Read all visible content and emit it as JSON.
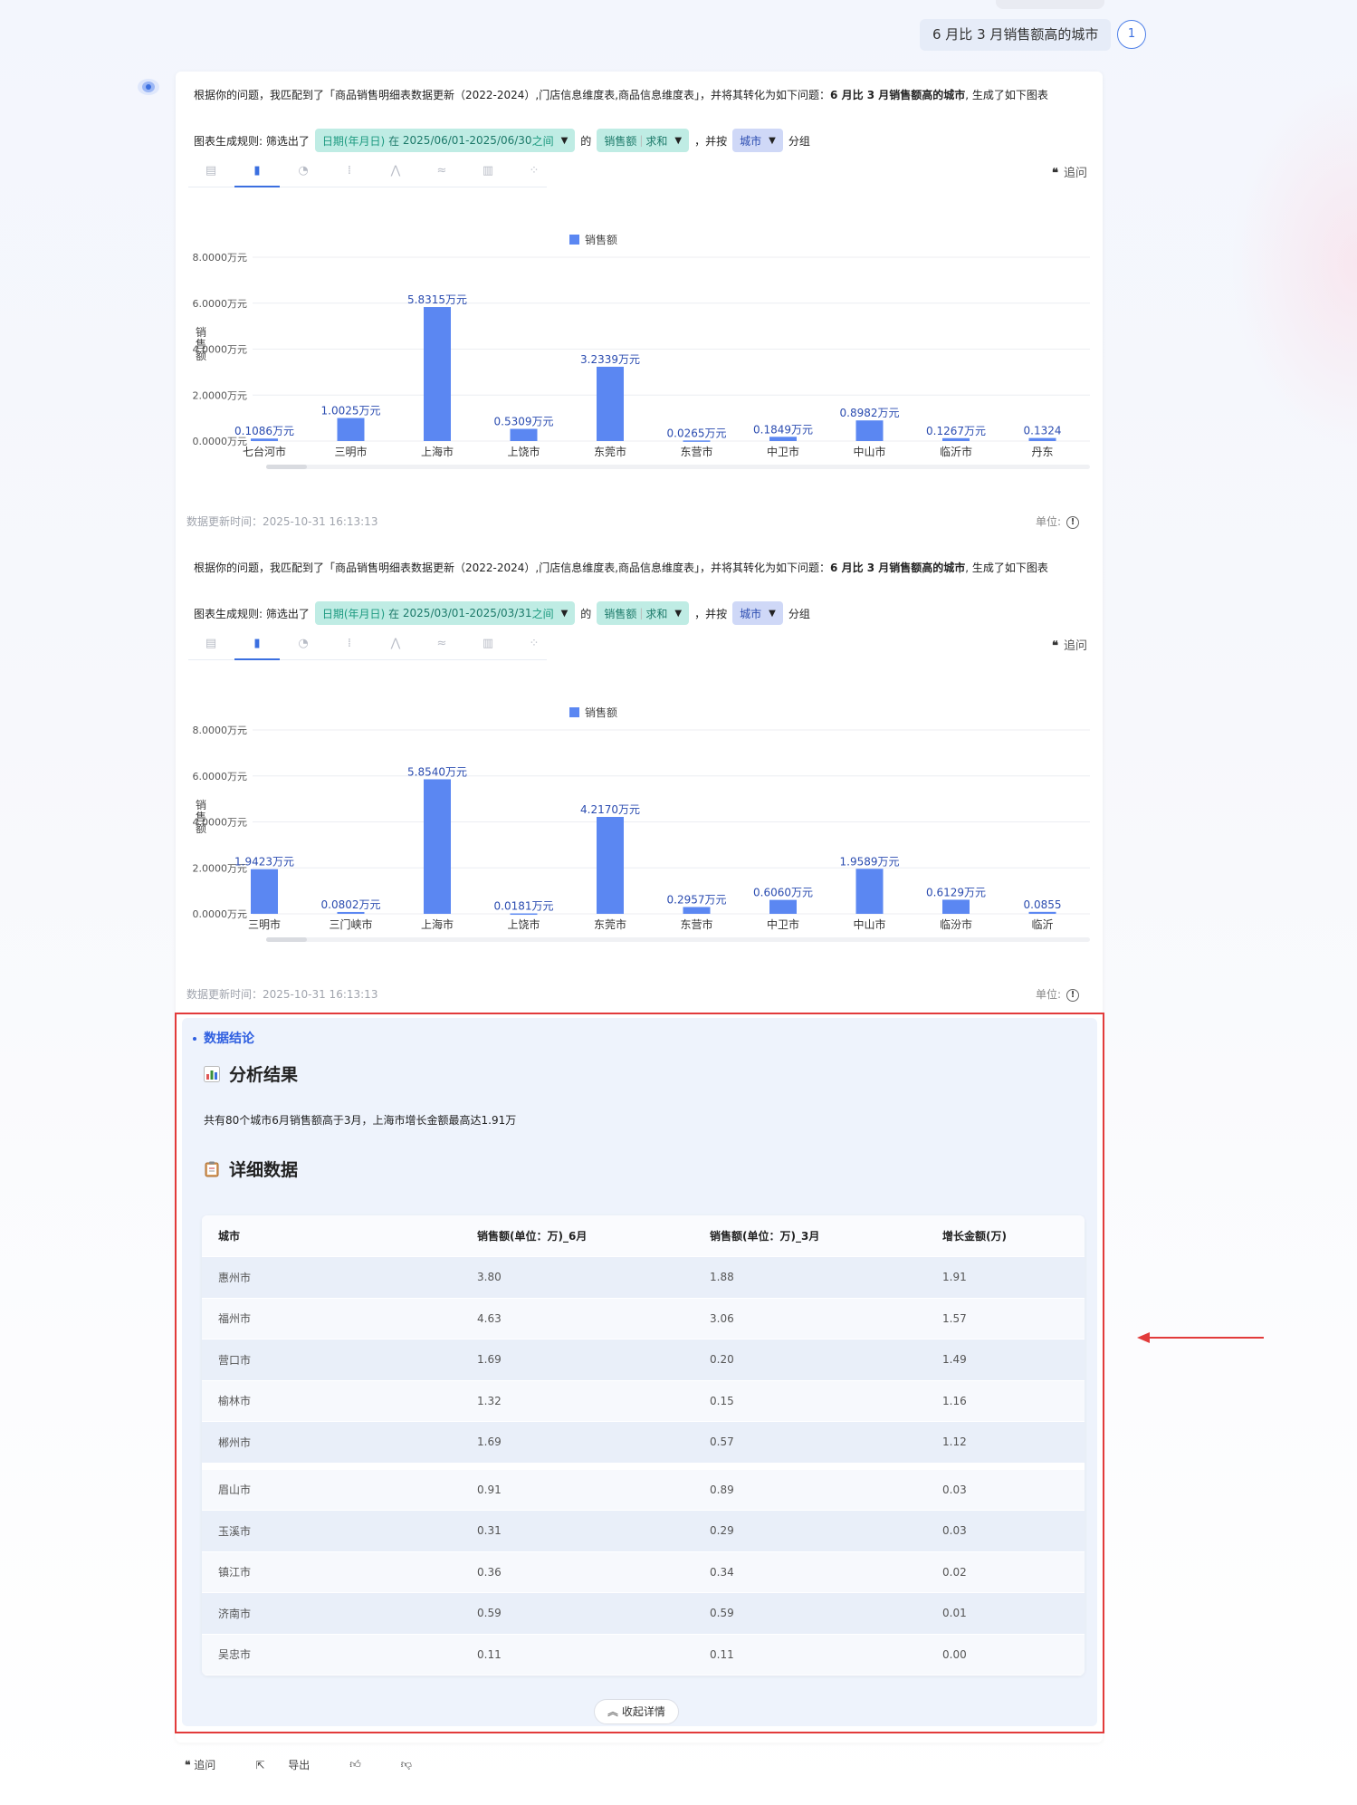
{
  "question": {
    "text": "6 月比 3 月销售额高的城市",
    "badge": "1"
  },
  "sections": [
    {
      "intro_pre": "根据你的问题，我匹配到了「商品销售明细表数据更新（2022-2024）,门店信息维度表,商品信息维度表」，并将其转化为如下问题：",
      "intro_bold": "6 月比 3 月销售额高的城市",
      "intro_post": ", 生成了如下图表",
      "rule_label": "图表生成规则: 筛选出了",
      "date_key": "日期(年月日)",
      "date_in": "在",
      "date_range": "2025/06/01-2025/06/30",
      "date_between": "之间",
      "de": "的",
      "metric": "销售额",
      "agg": "求和",
      "and_by": "，并按",
      "group": "城市",
      "group_suffix": "分组",
      "followup": "追问",
      "updated": "数据更新时间：2025-10-31 16:13:13",
      "unit": "单位:"
    },
    {
      "intro_pre": "根据你的问题，我匹配到了「商品销售明细表数据更新（2022-2024）,门店信息维度表,商品信息维度表」，并将其转化为如下问题：",
      "intro_bold": "6 月比 3 月销售额高的城市",
      "intro_post": ", 生成了如下图表",
      "rule_label": "图表生成规则: 筛选出了",
      "date_key": "日期(年月日)",
      "date_in": "在",
      "date_range": "2025/03/01-2025/03/31",
      "date_between": "之间",
      "de": "的",
      "metric": "销售额",
      "agg": "求和",
      "and_by": "，并按",
      "group": "城市",
      "group_suffix": "分组",
      "followup": "追问",
      "updated": "数据更新时间：2025-10-31 16:13:13",
      "unit": "单位:"
    }
  ],
  "chart_tabs": [
    "table-icon",
    "bar-chart-icon",
    "pie-chart-icon",
    "grouped-icon",
    "line-icon",
    "area-icon",
    "stacked-icon",
    "scatter-icon"
  ],
  "chart_data": [
    {
      "type": "bar",
      "legend": "销售额",
      "ylabel": "销售额",
      "ylim": [
        0,
        8
      ],
      "yticks": [
        "0.0000万元",
        "2.0000万元",
        "4.0000万元",
        "6.0000万元",
        "8.0000万元"
      ],
      "categories": [
        "七台河市",
        "三明市",
        "上海市",
        "上饶市",
        "东莞市",
        "东营市",
        "中卫市",
        "中山市",
        "临沂市",
        "丹东"
      ],
      "values": [
        0.1086,
        1.0025,
        5.8315,
        0.5309,
        3.2339,
        0.0265,
        0.1849,
        0.8982,
        0.1267,
        0.1324
      ],
      "labels": [
        "0.1086万元",
        "1.0025万元",
        "5.8315万元",
        "0.5309万元",
        "3.2339万元",
        "0.0265万元",
        "0.1849万元",
        "0.8982万元",
        "0.1267万元",
        "0.1324"
      ],
      "color": "#5b87f2"
    },
    {
      "type": "bar",
      "legend": "销售额",
      "ylabel": "销售额",
      "ylim": [
        0,
        8
      ],
      "yticks": [
        "0.0000万元",
        "2.0000万元",
        "4.0000万元",
        "6.0000万元",
        "8.0000万元"
      ],
      "categories": [
        "三明市",
        "三门峡市",
        "上海市",
        "上饶市",
        "东莞市",
        "东营市",
        "中卫市",
        "中山市",
        "临汾市",
        "临沂"
      ],
      "values": [
        1.9423,
        0.0802,
        5.854,
        0.0181,
        4.217,
        0.2957,
        0.606,
        1.9589,
        0.6129,
        0.0855
      ],
      "labels": [
        "1.9423万元",
        "0.0802万元",
        "5.8540万元",
        "0.0181万元",
        "4.2170万元",
        "0.2957万元",
        "0.6060万元",
        "1.9589万元",
        "0.6129万元",
        "0.0855"
      ],
      "color": "#5b87f2"
    }
  ],
  "conclusion": {
    "title": "数据结论",
    "analysis_heading": "分析结果",
    "summary": "共有80个城市6月销售额高于3月，上海市增长金额最高达1.91万",
    "detail_heading": "详细数据",
    "columns": [
      "城市",
      "销售额(单位：万)_6月",
      "销售额(单位：万)_3月",
      "增长金额(万)"
    ],
    "rows": [
      [
        "惠州市",
        "3.80",
        "1.88",
        "1.91"
      ],
      [
        "福州市",
        "4.63",
        "3.06",
        "1.57"
      ],
      [
        "营口市",
        "1.69",
        "0.20",
        "1.49"
      ],
      [
        "榆林市",
        "1.32",
        "0.15",
        "1.16"
      ],
      [
        "郴州市",
        "1.69",
        "0.57",
        "1.12"
      ],
      [
        "眉山市",
        "0.91",
        "0.89",
        "0.03"
      ],
      [
        "玉溪市",
        "0.31",
        "0.29",
        "0.03"
      ],
      [
        "镇江市",
        "0.36",
        "0.34",
        "0.02"
      ],
      [
        "济南市",
        "0.59",
        "0.59",
        "0.01"
      ],
      [
        "吴忠市",
        "0.11",
        "0.11",
        "0.00"
      ]
    ],
    "collapse_label": "收起详情"
  },
  "actions": {
    "followup": "追问",
    "export": "导出"
  },
  "colors": {
    "accent": "#3b6fe0",
    "bar": "#5b87f2",
    "highlight_border": "#e23b3b"
  }
}
